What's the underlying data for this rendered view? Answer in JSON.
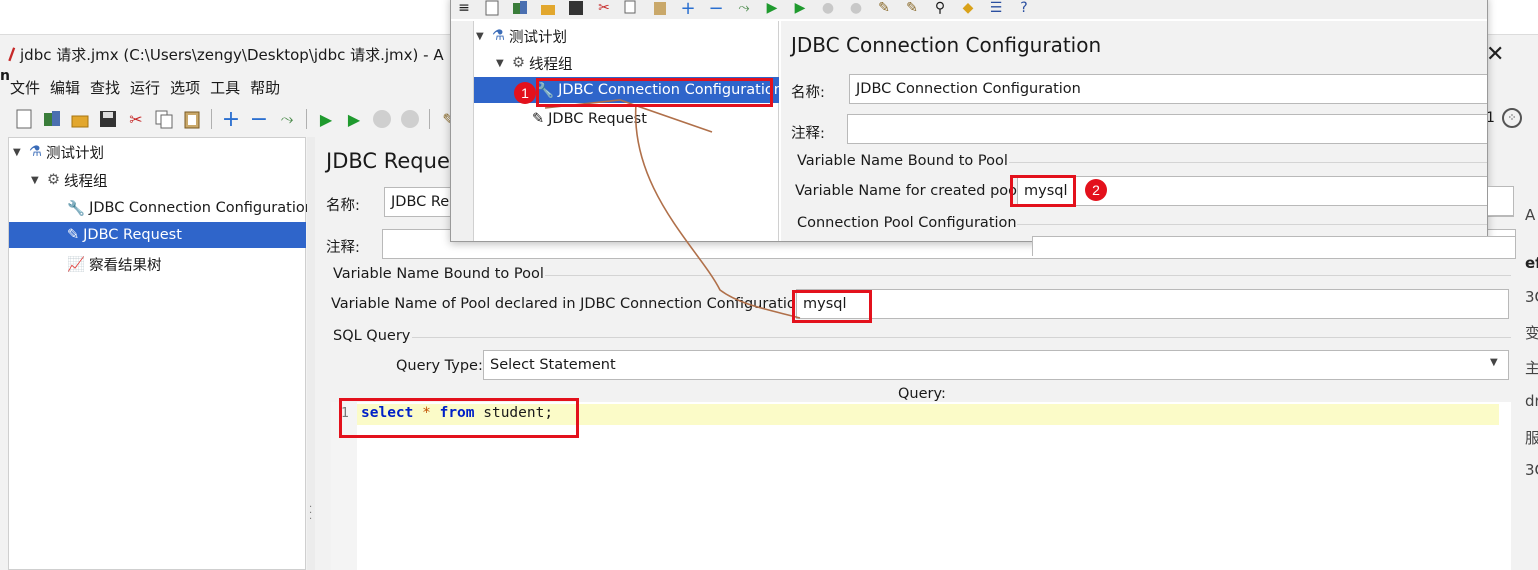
{
  "main_window": {
    "title": "jdbc 请求.jmx (C:\\Users\\zengy\\Desktop\\jdbc 请求.jmx) - A",
    "close_label": "✕",
    "clipped_letter": "n",
    "menu": [
      "文件",
      "编辑",
      "查找",
      "运行",
      "选项",
      "工具",
      "帮助"
    ],
    "toolbar_right_number": "1",
    "tree": [
      {
        "label": "测试计划",
        "icon": "flask-icon"
      },
      {
        "label": "线程组",
        "icon": "gear-icon"
      },
      {
        "label": "JDBC Connection Configuration",
        "icon": "wrench-icon"
      },
      {
        "label": "JDBC Request",
        "icon": "dropper-icon"
      },
      {
        "label": "察看结果树",
        "icon": "chart-icon"
      }
    ],
    "form": {
      "title": "JDBC Request",
      "name_label": "名称:",
      "name_value": "JDBC Req",
      "comment_label": "注释:",
      "comment_value": "",
      "group_pool": "Variable Name Bound to Pool",
      "pool_label": "Variable Name of Pool declared in JDBC Connection Configuration:",
      "pool_value": "mysql",
      "group_sql": "SQL Query",
      "query_type_label": "Query Type:",
      "query_type_value": "Select Statement",
      "query_label": "Query:",
      "line_no": "1",
      "code": {
        "kw1": "select",
        "op": " * ",
        "kw2": "from",
        "rest": " student;"
      }
    },
    "edge_chars": [
      "A",
      "ef",
      "3C",
      "变",
      "主",
      "dr",
      "服",
      "3C"
    ]
  },
  "overlay_window": {
    "tree": [
      {
        "label": "测试计划",
        "icon": "flask-icon"
      },
      {
        "label": "线程组",
        "icon": "gear-icon"
      },
      {
        "label": "JDBC Connection Configuration",
        "icon": "wrench-icon"
      },
      {
        "label": "JDBC Request",
        "icon": "dropper-icon"
      }
    ],
    "form": {
      "title": "JDBC Connection Configuration",
      "name_label": "名称:",
      "name_value": "JDBC Connection Configuration",
      "comment_label": "注释:",
      "comment_value": "",
      "group_pool": "Variable Name Bound to Pool",
      "var_label": "Variable Name for created pool",
      "var_value": "mysql",
      "group_conn": "Connection Pool Configuration"
    }
  },
  "annotations": {
    "badge1": "1",
    "badge2": "2",
    "box_color": "#e3111c",
    "arrow_color": "#b0704a"
  }
}
